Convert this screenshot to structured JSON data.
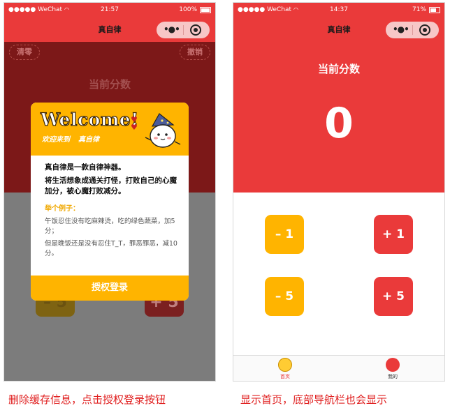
{
  "left_screen": {
    "status": {
      "carrier": "●●●●● WeChat",
      "time": "21:57",
      "battery": "100%"
    },
    "title": "真自律",
    "clear_label": "清零",
    "undo_label": "撤销",
    "score_title": "当前分数",
    "dim_minus": "– 5",
    "dim_plus": "+ 5",
    "modal": {
      "welcome": "Welcome!",
      "subtitle_1": "欢迎来到",
      "subtitle_2": "真自律",
      "intro": "真自律是一款自律神器。",
      "desc": "将生活想象成通关打怪，打败自己的心魔加分，被心魔打败减分。",
      "example_title": "举个例子：",
      "example_1": "午饭忍住没有吃麻辣烫，吃的绿色蔬菜，加5分；",
      "example_2": "但是晚饭还是没有忍住T_T，罪恶罪恶，减10分。",
      "auth_button": "授权登录"
    }
  },
  "right_screen": {
    "status": {
      "carrier": "●●●●● WeChat",
      "time": "14:37",
      "battery": "71%"
    },
    "title": "真自律",
    "score_title": "当前分数",
    "score_value": "0",
    "buttons": {
      "minus_1": "– 1",
      "plus_1": "+ 1",
      "minus_5": "– 5",
      "plus_5": "+ 5"
    },
    "tabs": {
      "home": "首页",
      "mine": "我的"
    }
  },
  "captions": {
    "left": "删除缓存信息，点击授权登录按钮",
    "right": "显示首页，底部导航栏也会显示"
  },
  "colors": {
    "brand_red": "#ea3a3a",
    "accent_yellow": "#ffb400"
  },
  "icons": [
    "wifi-icon",
    "battery-icon",
    "more-dots-icon",
    "close-target-icon",
    "mascot-icon",
    "home-tab-icon",
    "mine-tab-icon"
  ]
}
